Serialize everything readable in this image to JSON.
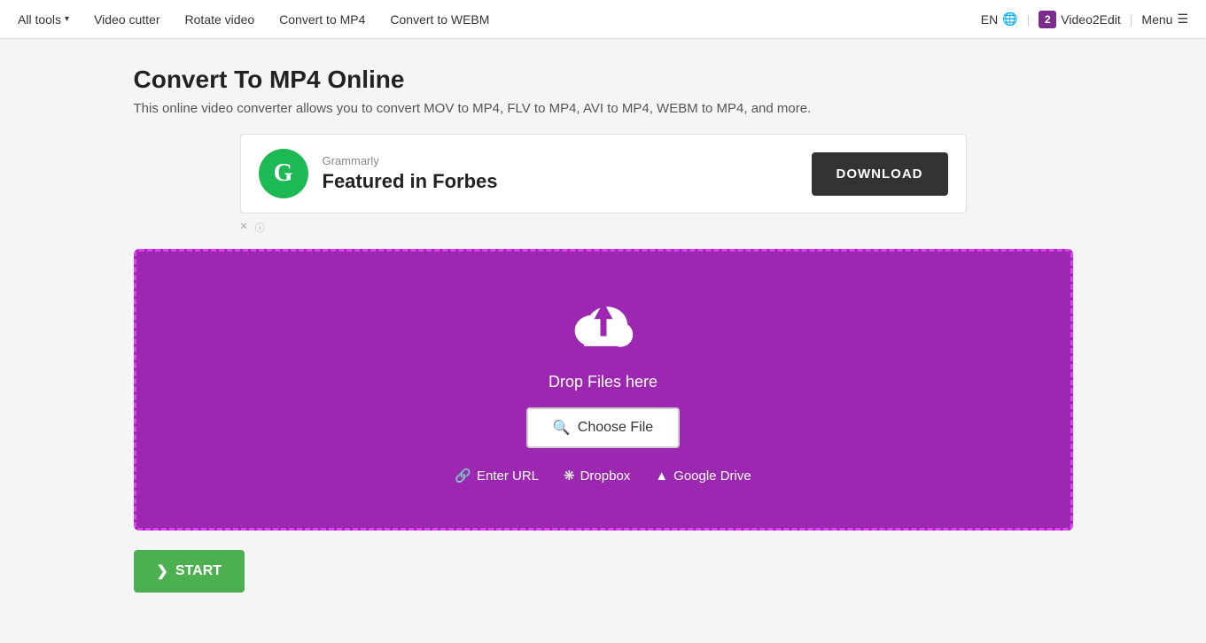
{
  "nav": {
    "all_tools_label": "All tools",
    "items": [
      {
        "label": "Video cutter"
      },
      {
        "label": "Rotate video"
      },
      {
        "label": "Convert to MP4"
      },
      {
        "label": "Convert to WEBM"
      }
    ],
    "lang": "EN",
    "brand": "Video2Edit",
    "menu": "Menu"
  },
  "header": {
    "title": "Convert To MP4 Online",
    "description": "This online video converter allows you to convert MOV to MP4, FLV to MP4, AVI to MP4, WEBM to MP4, and more."
  },
  "ad": {
    "logo_letter": "G",
    "brand_name": "Grammarly",
    "headline": "Featured in Forbes",
    "cta_label": "DOWNLOAD"
  },
  "dropzone": {
    "drop_text": "Drop Files here",
    "choose_label": "Choose File",
    "enter_url_label": "Enter URL",
    "dropbox_label": "Dropbox",
    "google_drive_label": "Google Drive"
  },
  "toolbar": {
    "start_label": "START"
  }
}
